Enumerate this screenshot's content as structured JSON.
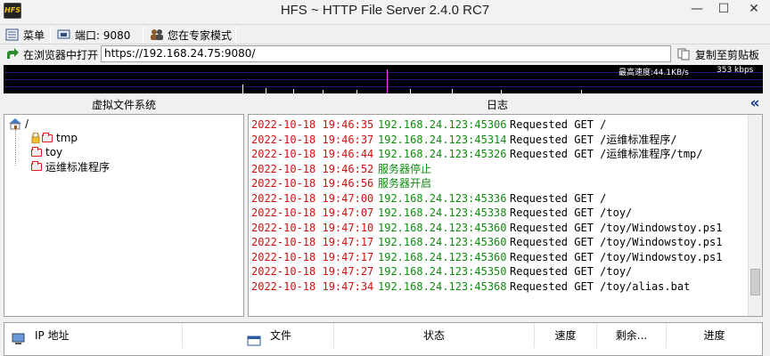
{
  "window": {
    "title": "HFS ~ HTTP File Server 2.4.0 RC7",
    "app_icon_text": "HFS",
    "minimize_glyph": "—",
    "maximize_glyph": "☐",
    "close_glyph": "✕"
  },
  "toolbar": {
    "menu_label": "菜单",
    "port_label": "端口: 9080",
    "mode_label": "您在专家模式"
  },
  "address": {
    "open_browser_label": "在浏览器中打开",
    "url": "https://192.168.24.75:9080/",
    "copy_label": "复制至剪贴板"
  },
  "graph": {
    "max_speed": "最高速度:44.1KB/s",
    "current_speed": "353 kbps",
    "bars": [
      {
        "pos": 0.315,
        "level": 0.3,
        "color": "#ffffff"
      },
      {
        "pos": 0.345,
        "level": 0.2,
        "color": "#ffffff"
      },
      {
        "pos": 0.382,
        "level": 0.15,
        "color": "#ffffff"
      },
      {
        "pos": 0.42,
        "level": 0.12,
        "color": "#ffffff"
      },
      {
        "pos": 0.465,
        "level": 0.12,
        "color": "#ffffff"
      },
      {
        "pos": 0.505,
        "level": 0.85,
        "color": "#ff40ff"
      },
      {
        "pos": 0.535,
        "level": 0.15,
        "color": "#ffffff"
      },
      {
        "pos": 0.59,
        "level": 0.15,
        "color": "#ffffff"
      },
      {
        "pos": 0.655,
        "level": 0.12,
        "color": "#ffffff"
      },
      {
        "pos": 0.76,
        "level": 0.12,
        "color": "#ffffff"
      }
    ]
  },
  "left_panel": {
    "title": "虚拟文件系统",
    "root": "/",
    "items": [
      "tmp",
      "toy",
      "运维标准程序"
    ]
  },
  "log_panel": {
    "title": "日志",
    "collapse_glyph": "«",
    "entries": [
      {
        "time": "2022-10-18 19:46:35",
        "addr": "192.168.24.123:45306",
        "msg": "Requested GET /"
      },
      {
        "time": "2022-10-18 19:46:37",
        "addr": "192.168.24.123:45314",
        "msg": "Requested GET /运维标准程序/"
      },
      {
        "time": "2022-10-18 19:46:44",
        "addr": "192.168.24.123:45326",
        "msg": "Requested GET /运维标准程序/tmp/"
      },
      {
        "time": "2022-10-18 19:46:52",
        "addr": "服务器停止",
        "msg": ""
      },
      {
        "time": "2022-10-18 19:46:56",
        "addr": "服务器开启",
        "msg": ""
      },
      {
        "time": "2022-10-18 19:47:00",
        "addr": "192.168.24.123:45336",
        "msg": "Requested GET /"
      },
      {
        "time": "2022-10-18 19:47:07",
        "addr": "192.168.24.123:45338",
        "msg": "Requested GET /toy/"
      },
      {
        "time": "2022-10-18 19:47:10",
        "addr": "192.168.24.123:45360",
        "msg": "Requested GET /toy/Windowstoy.ps1"
      },
      {
        "time": "2022-10-18 19:47:17",
        "addr": "192.168.24.123:45360",
        "msg": "Requested GET /toy/Windowstoy.ps1"
      },
      {
        "time": "2022-10-18 19:47:17",
        "addr": "192.168.24.123:45360",
        "msg": "Requested GET /toy/Windowstoy.ps1"
      },
      {
        "time": "2022-10-18 19:47:27",
        "addr": "192.168.24.123:45350",
        "msg": "Requested GET /toy/"
      },
      {
        "time": "2022-10-18 19:47:34",
        "addr": "192.168.24.123:45368",
        "msg": "Requested GET /toy/alias.bat"
      }
    ],
    "scroll_position": 0.9
  },
  "connections": {
    "columns": [
      "IP 地址",
      "文件",
      "状态",
      "速度",
      "剩余...",
      "进度"
    ]
  },
  "colors": {
    "log_time": "#d01010",
    "log_addr": "#108a10",
    "graph_bg": "#000000",
    "graph_highlight": "#ff40ff"
  }
}
